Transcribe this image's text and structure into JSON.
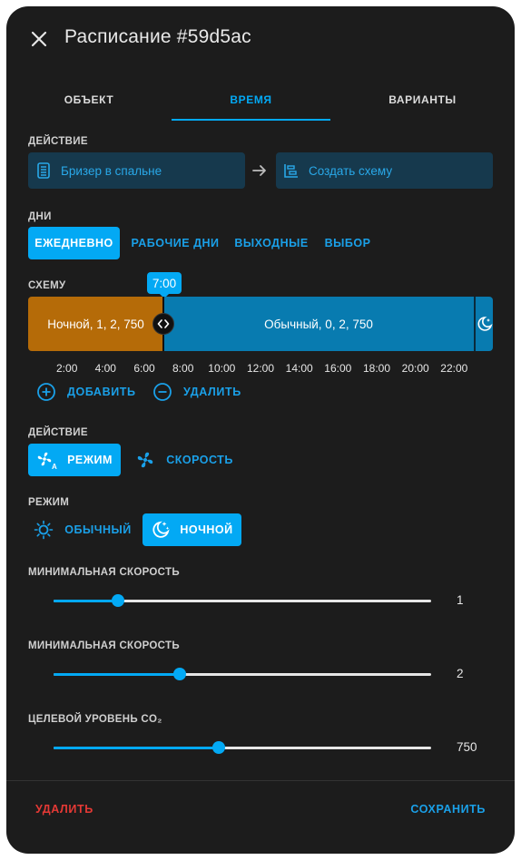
{
  "dialog": {
    "title": "Расписание #59d5ac"
  },
  "tabs": [
    {
      "label": "ОБЪЕКТ",
      "active": false
    },
    {
      "label": "ВРЕМЯ",
      "active": true
    },
    {
      "label": "ВАРИАНТЫ",
      "active": false
    }
  ],
  "action_section": {
    "label": "ДЕЙСТВИЕ",
    "target": {
      "label": "Бризер в спальне",
      "icon": "air-purifier-icon"
    },
    "arrow_icon": "arrow-right-icon",
    "create_scheme": {
      "label": "Создать схему",
      "icon": "timeline-icon"
    }
  },
  "days": {
    "label": "ДНИ",
    "options": [
      "ЕЖЕДНЕВНО",
      "РАБОЧИЕ ДНИ",
      "ВЫХОДНЫЕ",
      "ВЫБОР"
    ],
    "selected": "ЕЖЕДНЕВНО"
  },
  "scheme": {
    "label": "СХЕМУ",
    "time_bubble": "7:00",
    "segments": [
      {
        "label": "Ночной, 1, 2, 750",
        "color": "#b56b08"
      },
      {
        "label": "Обычный, 0, 2, 750",
        "color": "#087bb0"
      }
    ],
    "tail_icon": "weather-night-icon",
    "handle_icon": "code-arrows-icon",
    "ticks": [
      "2:00",
      "4:00",
      "6:00",
      "8:00",
      "10:00",
      "12:00",
      "14:00",
      "16:00",
      "18:00",
      "20:00",
      "22:00"
    ],
    "add_label": "ДОБАВИТЬ",
    "remove_label": "УДАЛИТЬ"
  },
  "action_type": {
    "label": "ДЕЙСТВИЕ",
    "options": [
      {
        "label": "РЕЖИМ",
        "icon": "fan-auto-icon",
        "selected": true
      },
      {
        "label": "СКОРОСТЬ",
        "icon": "fan-icon",
        "selected": false
      }
    ]
  },
  "mode": {
    "label": "РЕЖИМ",
    "options": [
      {
        "label": "ОБЫЧНЫЙ",
        "icon": "sun-icon",
        "selected": false
      },
      {
        "label": "НОЧНОЙ",
        "icon": "weather-night-icon",
        "selected": true
      }
    ]
  },
  "sliders": [
    {
      "label": "МИНИМАЛЬНАЯ СКОРОСТЬ",
      "value": "1",
      "fraction": 0.17
    },
    {
      "label": "МИНИМАЛЬНАЯ СКОРОСТЬ",
      "value": "2",
      "fraction": 0.334
    },
    {
      "label": "ЦЕЛЕВОЙ УРОВЕНЬ CO₂",
      "value": "750",
      "fraction": 0.437
    }
  ],
  "footer": {
    "delete_label": "УДАЛИТЬ",
    "save_label": "СОХРАНИТЬ"
  },
  "colors": {
    "accent": "#03a9f4",
    "danger": "#e53935",
    "background": "#1c1c1c"
  }
}
